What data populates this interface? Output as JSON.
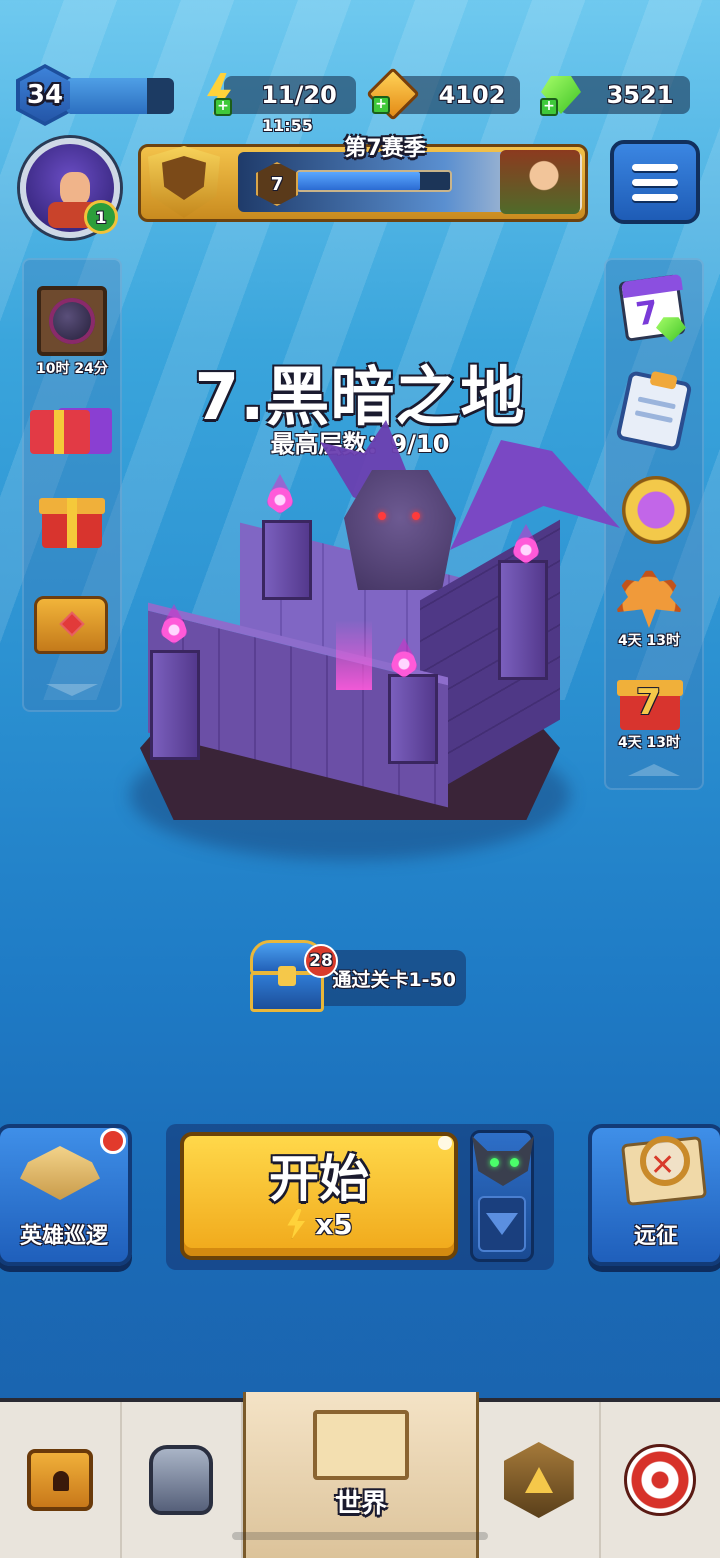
{
  "player": {
    "level": "34",
    "xp_fraction": 0.75,
    "badge_count": "1"
  },
  "resources": {
    "energy": "11/20",
    "energy_timer": "11:55",
    "gold": "4102",
    "gems": "3521"
  },
  "season": {
    "title": "第7赛季",
    "level": "7",
    "progress_fraction": 0.8
  },
  "left_panel": [
    {
      "name": "dark-orb-event",
      "label": "10时 24分"
    },
    {
      "name": "gift-pack",
      "label": ""
    },
    {
      "name": "red-gift",
      "label": ""
    },
    {
      "name": "treasure-chest",
      "label": ""
    }
  ],
  "right_panel": [
    {
      "name": "calendar-7",
      "label": "",
      "number": "7"
    },
    {
      "name": "quest-board",
      "label": ""
    },
    {
      "name": "purple-coin",
      "label": ""
    },
    {
      "name": "autumn-leaf",
      "label": "4天 13时"
    },
    {
      "name": "gift-7",
      "label": "4天 13时",
      "number": "7"
    }
  ],
  "stage": {
    "title": "7.黑暗之地",
    "best_floor": "最高层数：9/10"
  },
  "chest_reward": {
    "badge": "28",
    "text": "通过关卡1-50"
  },
  "actions": {
    "patrol_label": "英雄巡逻",
    "start_label": "开始",
    "start_cost": "x5",
    "expedition_label": "远征"
  },
  "nav": {
    "world_label": "世界"
  },
  "colors": {
    "accent_gold": "#f0a81a",
    "sky_blue": "#2a8fd0",
    "castle_purple": "#6b4fa6"
  }
}
